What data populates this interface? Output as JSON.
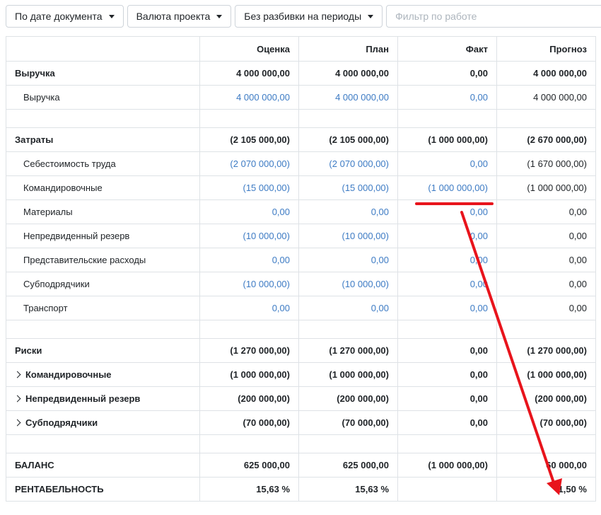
{
  "toolbar": {
    "date_mode": "По дате документа",
    "currency": "Валюта проекта",
    "period": "Без разбивки на периоды",
    "filter_placeholder": "Фильтр по работе",
    "filter_value": ""
  },
  "table": {
    "columns": [
      "",
      "Оценка",
      "План",
      "Факт",
      "Прогноз"
    ],
    "revenue": {
      "header": {
        "label": "Выручка",
        "estimate": "4 000 000,00",
        "plan": "4 000 000,00",
        "fact": "0,00",
        "forecast": "4 000 000,00"
      },
      "items": [
        {
          "label": "Выручка",
          "estimate": "4 000 000,00",
          "plan": "4 000 000,00",
          "fact": "0,00",
          "forecast": "4 000 000,00"
        }
      ]
    },
    "costs": {
      "header": {
        "label": "Затраты",
        "estimate": "(2 105 000,00)",
        "plan": "(2 105 000,00)",
        "fact": "(1 000 000,00)",
        "forecast": "(2 670 000,00)"
      },
      "items": [
        {
          "label": "Себестоимость труда",
          "estimate": "(2 070 000,00)",
          "plan": "(2 070 000,00)",
          "fact": "0,00",
          "forecast": "(1 670 000,00)"
        },
        {
          "label": "Командировочные",
          "estimate": "(15 000,00)",
          "plan": "(15 000,00)",
          "fact": "(1 000 000,00)",
          "forecast": "(1 000 000,00)"
        },
        {
          "label": "Материалы",
          "estimate": "0,00",
          "plan": "0,00",
          "fact": "0,00",
          "forecast": "0,00"
        },
        {
          "label": "Непредвиденный резерв",
          "estimate": "(10 000,00)",
          "plan": "(10 000,00)",
          "fact": "0,00",
          "forecast": "0,00"
        },
        {
          "label": "Представительские расходы",
          "estimate": "0,00",
          "plan": "0,00",
          "fact": "0,00",
          "forecast": "0,00"
        },
        {
          "label": "Субподрядчики",
          "estimate": "(10 000,00)",
          "plan": "(10 000,00)",
          "fact": "0,00",
          "forecast": "0,00"
        },
        {
          "label": "Транспорт",
          "estimate": "0,00",
          "plan": "0,00",
          "fact": "0,00",
          "forecast": "0,00"
        }
      ]
    },
    "risks": {
      "header": {
        "label": "Риски",
        "estimate": "(1 270 000,00)",
        "plan": "(1 270 000,00)",
        "fact": "0,00",
        "forecast": "(1 270 000,00)"
      },
      "items": [
        {
          "label": "Командировочные",
          "estimate": "(1 000 000,00)",
          "plan": "(1 000 000,00)",
          "fact": "0,00",
          "forecast": "(1 000 000,00)"
        },
        {
          "label": "Непредвиденный резерв",
          "estimate": "(200 000,00)",
          "plan": "(200 000,00)",
          "fact": "0,00",
          "forecast": "(200 000,00)"
        },
        {
          "label": "Субподрядчики",
          "estimate": "(70 000,00)",
          "plan": "(70 000,00)",
          "fact": "0,00",
          "forecast": "(70 000,00)"
        }
      ]
    },
    "balance": {
      "label": "БАЛАНС",
      "estimate": "625 000,00",
      "plan": "625 000,00",
      "fact": "(1 000 000,00)",
      "forecast": "60 000,00"
    },
    "profitability": {
      "label": "РЕНТАБЕЛЬНОСТЬ",
      "estimate": "15,63 %",
      "plan": "15,63 %",
      "fact": "",
      "forecast": "1,50 %"
    }
  },
  "colors": {
    "link": "#3d7bc4",
    "annotation": "#e8141c",
    "border": "#dee2e6"
  }
}
